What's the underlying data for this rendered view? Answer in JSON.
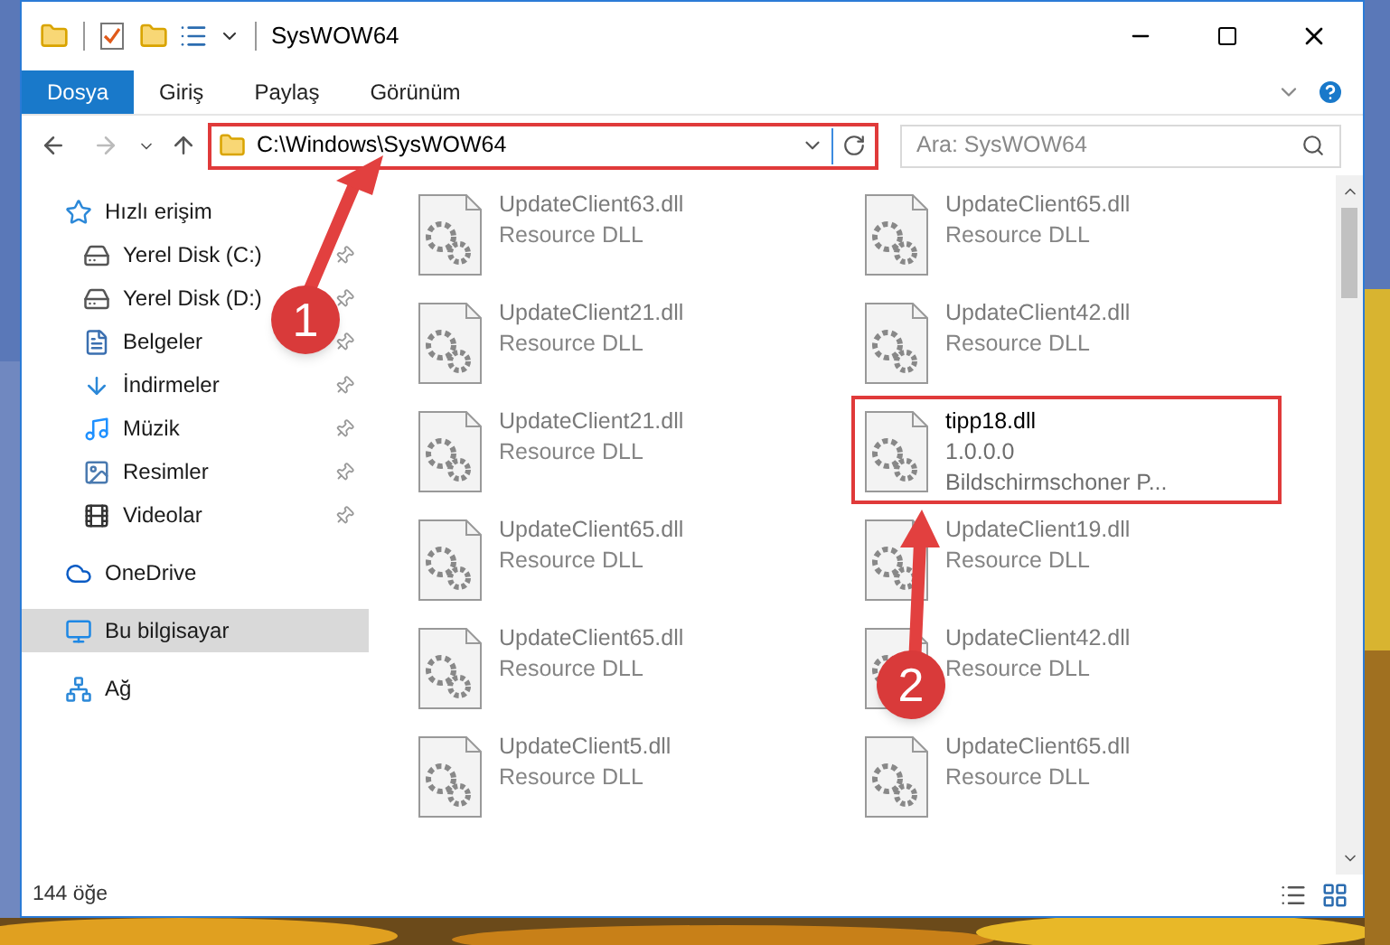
{
  "window": {
    "title": "SysWOW64"
  },
  "ribbon_tabs": [
    {
      "label": "Dosya",
      "selected": true
    },
    {
      "label": "Giriş",
      "selected": false
    },
    {
      "label": "Paylaş",
      "selected": false
    },
    {
      "label": "Görünüm",
      "selected": false
    }
  ],
  "address_bar": {
    "path": "C:\\Windows\\SysWOW64"
  },
  "search": {
    "placeholder": "Ara: SysWOW64"
  },
  "sidebar": {
    "items": [
      {
        "label": "Hızlı erişim",
        "kind": "star",
        "selected": false,
        "children": [
          {
            "label": "Yerel Disk (C:)",
            "kind": "disk",
            "pinned": true,
            "selected": false
          },
          {
            "label": "Yerel Disk (D:)",
            "kind": "disk",
            "pinned": true,
            "selected": false
          },
          {
            "label": "Belgeler",
            "kind": "docs",
            "pinned": true,
            "selected": false
          },
          {
            "label": "İndirmeler",
            "kind": "download",
            "pinned": true,
            "selected": false
          },
          {
            "label": "Müzik",
            "kind": "music",
            "pinned": true,
            "selected": false
          },
          {
            "label": "Resimler",
            "kind": "pictures",
            "pinned": true,
            "selected": false
          },
          {
            "label": "Videolar",
            "kind": "videos",
            "pinned": true,
            "selected": false
          }
        ]
      },
      {
        "label": "OneDrive",
        "kind": "cloud",
        "selected": false
      },
      {
        "label": "Bu bilgisayar",
        "kind": "pc",
        "selected": true
      },
      {
        "label": "Ağ",
        "kind": "network",
        "selected": false
      }
    ]
  },
  "files": [
    {
      "name": "UpdateClient63.dll",
      "lines": [
        "Resource DLL"
      ],
      "blurred": true
    },
    {
      "name": "UpdateClient65.dll",
      "lines": [
        "Resource DLL"
      ],
      "blurred": true
    },
    {
      "name": "UpdateClient21.dll",
      "lines": [
        "Resource DLL"
      ],
      "blurred": true
    },
    {
      "name": "UpdateClient42.dll",
      "lines": [
        "Resource DLL"
      ],
      "blurred": true
    },
    {
      "name": "UpdateClient21.dll",
      "lines": [
        "Resource DLL"
      ],
      "blurred": true
    },
    {
      "name": "tipp18.dll",
      "lines": [
        "1.0.0.0",
        "Bildschirmschoner P..."
      ],
      "blurred": false
    },
    {
      "name": "UpdateClient65.dll",
      "lines": [
        "Resource DLL"
      ],
      "blurred": true
    },
    {
      "name": "UpdateClient19.dll",
      "lines": [
        "Resource DLL"
      ],
      "blurred": true
    },
    {
      "name": "UpdateClient65.dll",
      "lines": [
        "Resource DLL"
      ],
      "blurred": true
    },
    {
      "name": "UpdateClient42.dll",
      "lines": [
        "Resource DLL"
      ],
      "blurred": true
    },
    {
      "name": "UpdateClient5.dll",
      "lines": [
        "Resource DLL"
      ],
      "blurred": true
    },
    {
      "name": "UpdateClient65.dll",
      "lines": [
        "Resource DLL"
      ],
      "blurred": true
    }
  ],
  "status_bar": {
    "count": "144 öğe"
  },
  "annotations": [
    {
      "label": "1"
    },
    {
      "label": "2"
    }
  ]
}
